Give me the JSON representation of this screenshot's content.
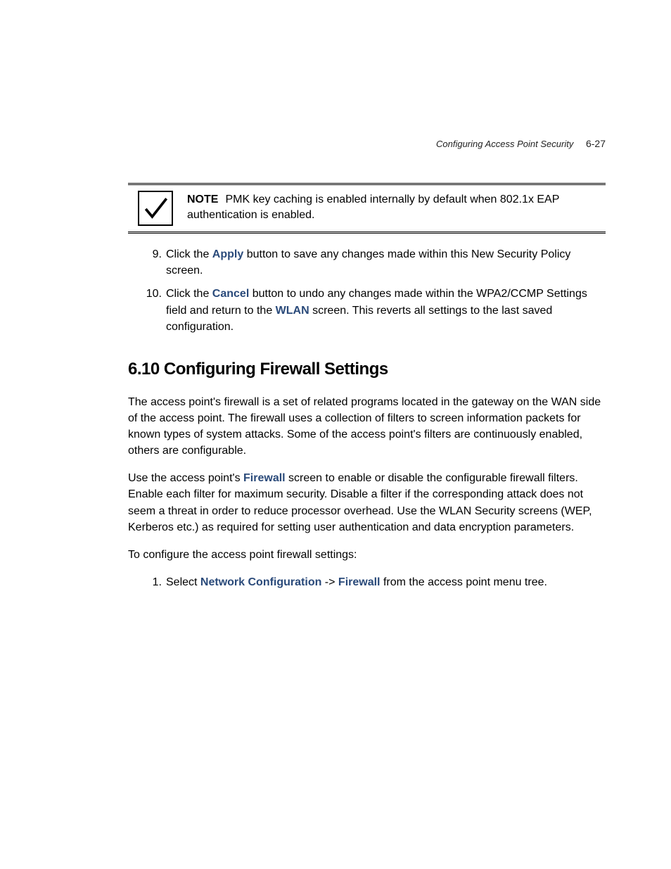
{
  "header": {
    "section_title": "Configuring Access Point Security",
    "page_number": "6-27"
  },
  "note": {
    "label": "NOTE",
    "text": "PMK key caching is enabled internally by default when 802.1x EAP authentication is enabled."
  },
  "steps": [
    {
      "num": "9.",
      "pre1": "Click the ",
      "bold1": "Apply",
      "post1": " button to save any changes made within this New Security Policy screen."
    },
    {
      "num": "10.",
      "pre1": "Click the ",
      "bold1": "Cancel",
      "mid1": " button to undo any changes made within the WPA2/CCMP Settings field and return to the ",
      "bold2": "WLAN",
      "post1": " screen. This reverts all settings to the last saved configuration."
    }
  ],
  "section_heading": "6.10  Configuring Firewall Settings",
  "para1": "The access point's firewall is a set of related programs located in the gateway on the WAN side of the access point. The firewall uses a collection of filters to screen information packets for known types of system attacks. Some of the access point's filters are continuously enabled, others are configurable.",
  "para2": {
    "pre": "Use the access point's ",
    "bold": "Firewall",
    "post": " screen to enable or disable the configurable firewall filters. Enable each filter for maximum security. Disable a filter if the corresponding attack does not seem a threat in order to reduce processor overhead. Use the WLAN Security screens (WEP, Kerberos etc.) as required for setting user authentication and data encryption parameters."
  },
  "para3": "To configure the access point firewall settings:",
  "substeps": [
    {
      "num": "1.",
      "pre": "Select ",
      "bold1": "Network Configuration",
      "mid": " -> ",
      "bold2": "Firewall",
      "post": " from the access point menu tree."
    }
  ]
}
